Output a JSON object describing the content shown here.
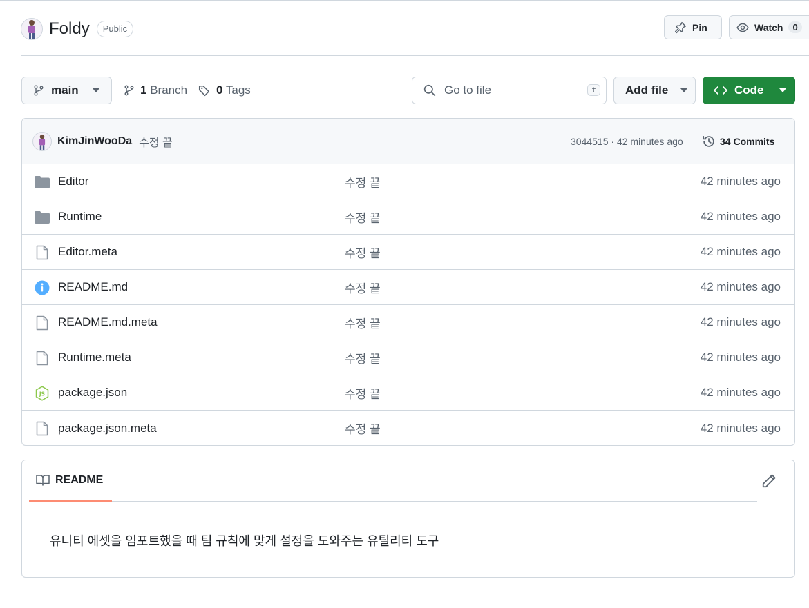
{
  "repo": {
    "name": "Foldy",
    "visibility": "Public"
  },
  "header_actions": {
    "pin_label": "Pin",
    "watch_label": "Watch",
    "watch_count": "0"
  },
  "toolbar": {
    "branch": "main",
    "branch_count": "1",
    "branch_label": "Branch",
    "tag_count": "0",
    "tag_label": "Tags",
    "search_placeholder": "Go to file",
    "search_shortcut": "t",
    "add_file_label": "Add file",
    "code_label": "Code"
  },
  "latest_commit": {
    "author": "KimJinWooDa",
    "message": "수정 끝",
    "hash_time": "3044515 · 42 minutes ago",
    "commits_label": "34 Commits"
  },
  "files": [
    {
      "icon": "folder-icon",
      "name": "Editor",
      "message": "수정 끝",
      "time": "42 minutes ago"
    },
    {
      "icon": "folder-icon",
      "name": "Runtime",
      "message": "수정 끝",
      "time": "42 minutes ago"
    },
    {
      "icon": "file-icon",
      "name": "Editor.meta",
      "message": "수정 끝",
      "time": "42 minutes ago"
    },
    {
      "icon": "info-icon",
      "name": "README.md",
      "message": "수정 끝",
      "time": "42 minutes ago"
    },
    {
      "icon": "file-icon",
      "name": "README.md.meta",
      "message": "수정 끝",
      "time": "42 minutes ago"
    },
    {
      "icon": "file-icon",
      "name": "Runtime.meta",
      "message": "수정 끝",
      "time": "42 minutes ago"
    },
    {
      "icon": "nodejs-icon",
      "name": "package.json",
      "message": "수정 끝",
      "time": "42 minutes ago"
    },
    {
      "icon": "file-icon",
      "name": "package.json.meta",
      "message": "수정 끝",
      "time": "42 minutes ago"
    }
  ],
  "readme": {
    "tab_label": "README",
    "body": "유니티 에셋을 임포트했을 때 팀 규칙에 맞게 설정을 도와주는 유틸리티 도구"
  },
  "colors": {
    "code_button": "#1f883d",
    "readme_tab_underline": "#fd8c73",
    "folder": "#8c959f",
    "info": "#54aeff",
    "nodejs": "#8cc84b"
  }
}
